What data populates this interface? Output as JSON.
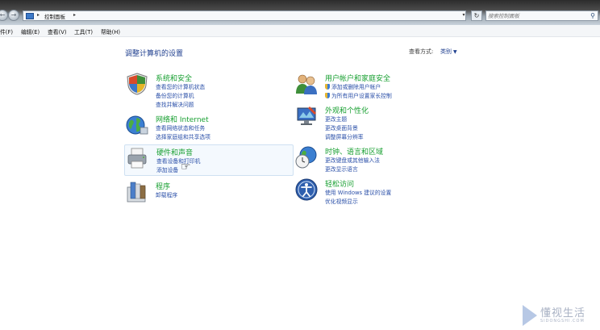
{
  "address_bar": {
    "crumb": "控制面板"
  },
  "search": {
    "placeholder": "搜索控制面板"
  },
  "menu": [
    "件(F)",
    "编辑(E)",
    "查看(V)",
    "工具(T)",
    "帮助(H)"
  ],
  "page": {
    "title": "调整计算机的设置",
    "view_by_label": "查看方式:",
    "view_by_value": "类别"
  },
  "categories": [
    {
      "title": "系统和安全",
      "links": [
        "查看您的计算机状态",
        "备份您的计算机",
        "查找并解决问题"
      ]
    },
    {
      "title": "网络和 Internet",
      "links": [
        "查看网络状态和任务",
        "选择家庭组和共享选项"
      ]
    },
    {
      "title": "硬件和声音",
      "links": [
        "查看设备和打印机",
        "添加设备"
      ]
    },
    {
      "title": "程序",
      "links": [
        "卸载程序"
      ]
    },
    {
      "title": "用户帐户和家庭安全",
      "links": [
        "添加或删除用户帐户",
        "为所有用户设置家长控制"
      ]
    },
    {
      "title": "外观和个性化",
      "links": [
        "更改主题",
        "更改桌面背景",
        "调整屏幕分辨率"
      ]
    },
    {
      "title": "时钟、语言和区域",
      "links": [
        "更改键盘或其他输入法",
        "更改显示语言"
      ]
    },
    {
      "title": "轻松访问",
      "links": [
        "使用 Windows 建议的设置",
        "优化视频显示"
      ]
    }
  ],
  "watermark": {
    "name": "懂视生活",
    "sub": "SIDONGSHI.COM"
  },
  "icons": [
    "back-arrow-icon",
    "forward-arrow-icon",
    "control-panel-icon",
    "refresh-icon",
    "search-icon",
    "shield-icon",
    "globe-icon",
    "printer-icon",
    "programs-icon",
    "users-icon",
    "monitor-icon",
    "clock-globe-icon",
    "accessibility-icon",
    "mouse-pointer-icon"
  ]
}
